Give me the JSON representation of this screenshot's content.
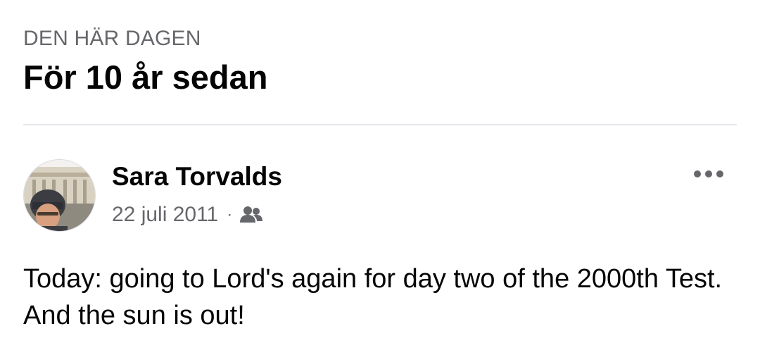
{
  "memories": {
    "section_label": "DEN HÄR DAGEN",
    "title": "För 10 år sedan"
  },
  "post": {
    "author": "Sara Torvalds",
    "date": "22 juli 2011",
    "separator": "·",
    "audience_icon": "friends-icon",
    "more_icon": "more-options-icon",
    "text": "Today: going to Lord's again for day two of the 2000th Test. And the sun is out!"
  },
  "colors": {
    "primary_text": "#050505",
    "secondary_text": "#65676b",
    "divider": "#e4e6eb"
  }
}
